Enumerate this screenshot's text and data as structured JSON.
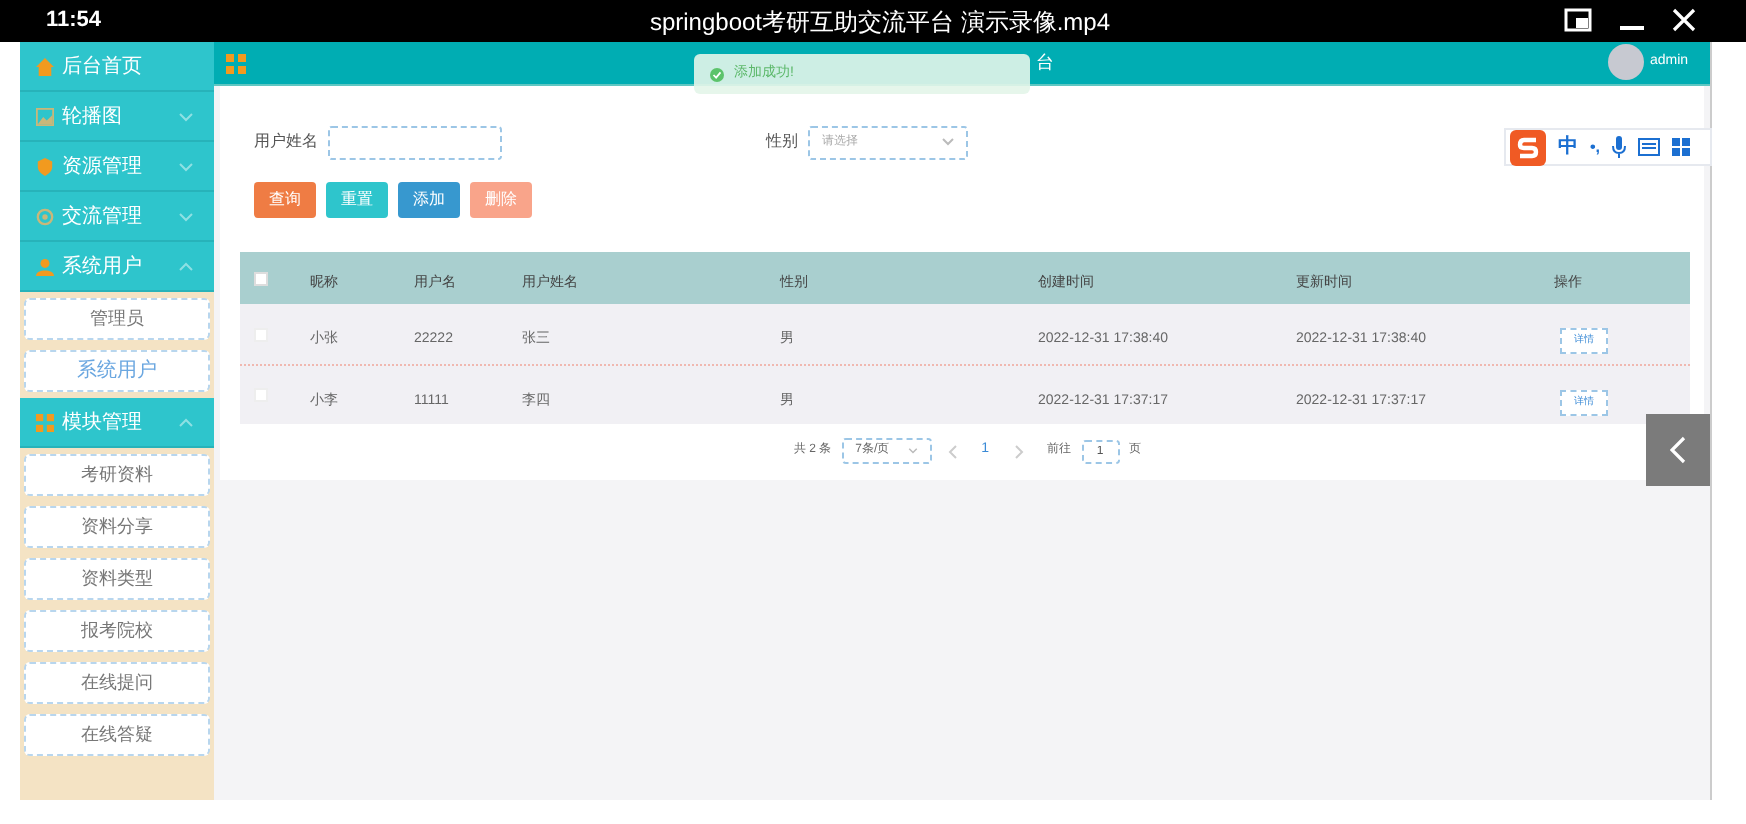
{
  "player": {
    "time": "11:54",
    "title": "springboot考研互助交流平台 演示录像.mp4"
  },
  "sidebar": {
    "items": [
      {
        "kind": "link",
        "label": "后台首页"
      },
      {
        "kind": "menu",
        "label": "轮播图",
        "expanded": false
      },
      {
        "kind": "menu",
        "label": "资源管理",
        "expanded": false
      },
      {
        "kind": "menu",
        "label": "交流管理",
        "expanded": false
      },
      {
        "kind": "menu",
        "label": "系统用户",
        "expanded": true,
        "children": [
          {
            "label": "管理员",
            "selected": false
          },
          {
            "label": "系统用户",
            "selected": true
          }
        ]
      },
      {
        "kind": "menu",
        "label": "模块管理",
        "expanded": true,
        "children": [
          {
            "label": "考研资料",
            "selected": false
          },
          {
            "label": "资料分享",
            "selected": false
          },
          {
            "label": "资料类型",
            "selected": false
          },
          {
            "label": "报考院校",
            "selected": false
          },
          {
            "label": "在线提问",
            "selected": false
          },
          {
            "label": "在线答疑",
            "selected": false
          }
        ]
      }
    ]
  },
  "header": {
    "title": "台",
    "user": "admin"
  },
  "toast": {
    "message": "添加成功!"
  },
  "ime": {
    "mode": "中",
    "punctuation": "•,"
  },
  "filters": [
    {
      "kind": "text",
      "label": "用户姓名"
    },
    {
      "kind": "select",
      "label": "性别",
      "placeholder": "请选择"
    }
  ],
  "buttons": [
    {
      "label": "查询",
      "color": "#ef7c44"
    },
    {
      "label": "重置",
      "color": "#2ec5cc"
    },
    {
      "label": "添加",
      "color": "#3798cf"
    },
    {
      "label": "删除",
      "color": "#f9a48a"
    }
  ],
  "table": {
    "select_all": false,
    "columns": [
      "昵称",
      "用户名",
      "用户姓名",
      "性别",
      "创建时间",
      "更新时间",
      "操作"
    ],
    "rows": [
      {
        "checked": false,
        "cells": [
          "小张",
          "22222",
          "张三",
          "男",
          "2022-12-31 17:38:40",
          "2022-12-31 17:38:40"
        ],
        "action": "详情"
      },
      {
        "checked": false,
        "cells": [
          "小李",
          "11111",
          "李四",
          "男",
          "2022-12-31 17:37:17",
          "2022-12-31 17:37:17"
        ],
        "action": "详情"
      }
    ]
  },
  "pagination": {
    "total": "共 2 条",
    "page_size": "7条/页",
    "pages": [
      {
        "label": "1",
        "selected": true
      }
    ],
    "goto_label": "前往",
    "goto_value": "1",
    "goto_suffix": "页"
  }
}
